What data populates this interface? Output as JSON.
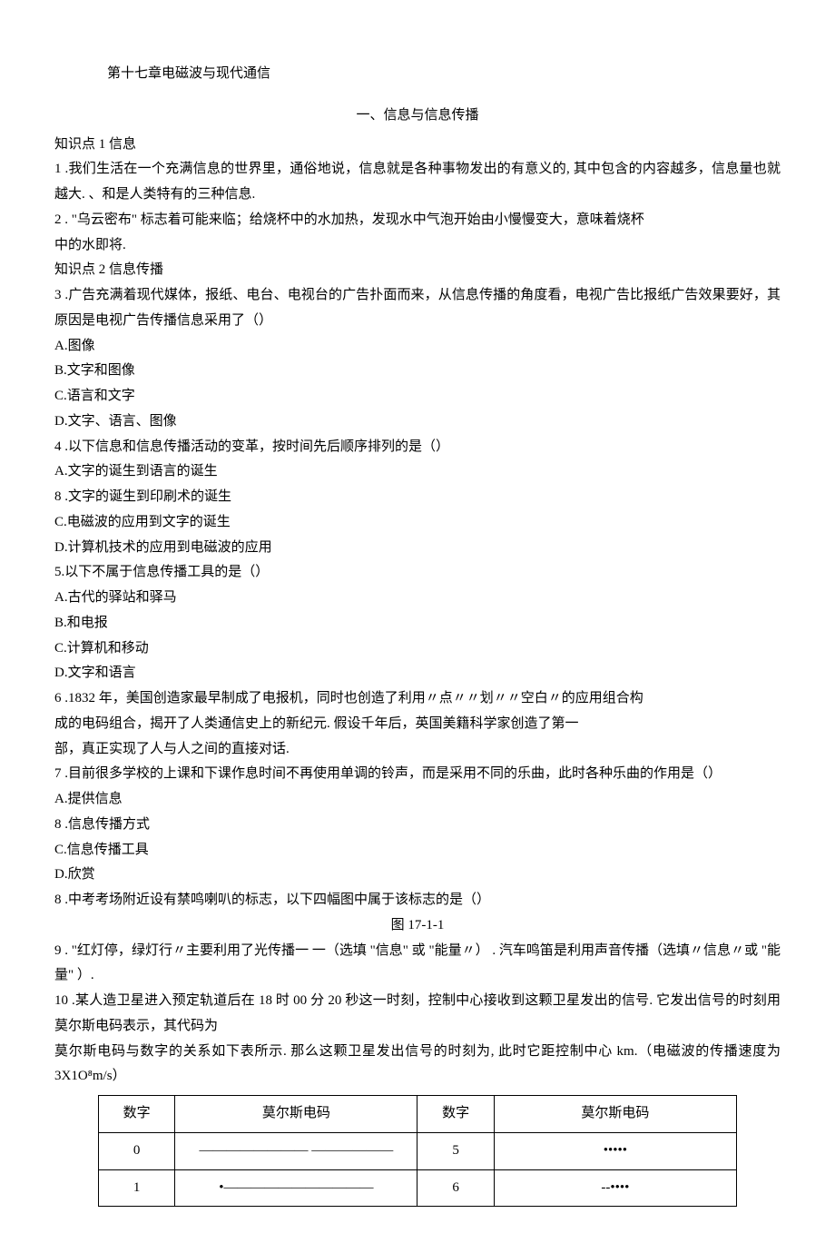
{
  "chapter": "第十七章电磁波与现代通信",
  "section": "一、信息与信息传播",
  "kp1": "知识点 1 信息",
  "q1": "1    .我们生活在一个充满信息的世界里，通俗地说，信息就是各种事物发出的有意义的, 其中包含的内容越多，信息量也就越大. 、和是人类特有的三种信息.",
  "q2": "2   . \"乌云密布\" 标志着可能来临；给烧杯中的水加热，发现水中气泡开始由小慢慢变大，意味着烧杯",
  "q2b": "中的水即将.",
  "kp2": "知识点 2 信息传播",
  "q3": "3    .广告充满着现代媒体，报纸、电台、电视台的广告扑面而来，从信息传播的角度看，电视广告比报纸广告效果要好，其原因是电视广告传播信息采用了（）",
  "q3a": "A.图像",
  "q3b": "B.文字和图像",
  "q3c": "C.语言和文字",
  "q3d": "D.文字、语言、图像",
  "q4": "4  .以下信息和信息传播活动的变革，按时间先后顺序排列的是（）",
  "q4a": "A.文字的诞生到语言的诞生",
  "q4b": "8  .文字的诞生到印刷术的诞生",
  "q4c": "C.电磁波的应用到文字的诞生",
  "q4d": "D.计算机技术的应用到电磁波的应用",
  "q5": "5.以下不属于信息传播工具的是（）",
  "q5a": "A.古代的驿站和驿马",
  "q5b": "B.和电报",
  "q5c": "C.计算机和移动",
  "q5d": "D.文字和语言",
  "q6": "6  .1832 年，美国创造家最早制成了电报机，同时也创造了利用〃点〃〃划〃〃空白〃的应用组合构",
  "q6b": "成的电码组合，揭开了人类通信史上的新纪元. 假设千年后，英国美籍科学家创造了第一",
  "q6c": "部，真正实现了人与人之间的直接对话.",
  "q7": "7    .目前很多学校的上课和下课作息时间不再使用单调的铃声，而是采用不同的乐曲，此时各种乐曲的作用是（）",
  "q7a": "A.提供信息",
  "q7b": "8  .信息传播方式",
  "q7c": "C.信息传播工具",
  "q7d": "D.欣赏",
  "q8": "8  .中考考场附近设有禁鸣喇叭的标志，以下四幅图中属于该标志的是（）",
  "fig": "图 17-1-1",
  "q9": "9   . \"红灯停，绿灯行〃主要利用了光传播一        一（选填 \"信息\" 或 \"能量〃） . 汽车鸣笛是利用声音传播（选填〃信息〃或 \"能量\" ）.",
  "q10": "10    .某人造卫星进入预定轨道后在 18 时 00 分 20 秒这一时刻，控制中心接收到这颗卫星发出的信号. 它发出信号的时刻用莫尔斯电码表示，其代码为",
  "q10b": "莫尔斯电码与数字的关系如下表所示. 那么这颗卫星发出信号的时刻为, 此时它距控制中心 km.（电磁波的传播速度为3X1O⁸m/s）",
  "table": {
    "h1": "数字",
    "h2": "莫尔斯电码",
    "h3": "数字",
    "h4": "莫尔斯电码",
    "r1c1": "0",
    "r1c2": "———————— ——————",
    "r1c3": "5",
    "r1c4": "•••••",
    "r2c1": "1",
    "r2c2": "•———————————",
    "r2c3": "6",
    "r2c4": "--••••"
  }
}
